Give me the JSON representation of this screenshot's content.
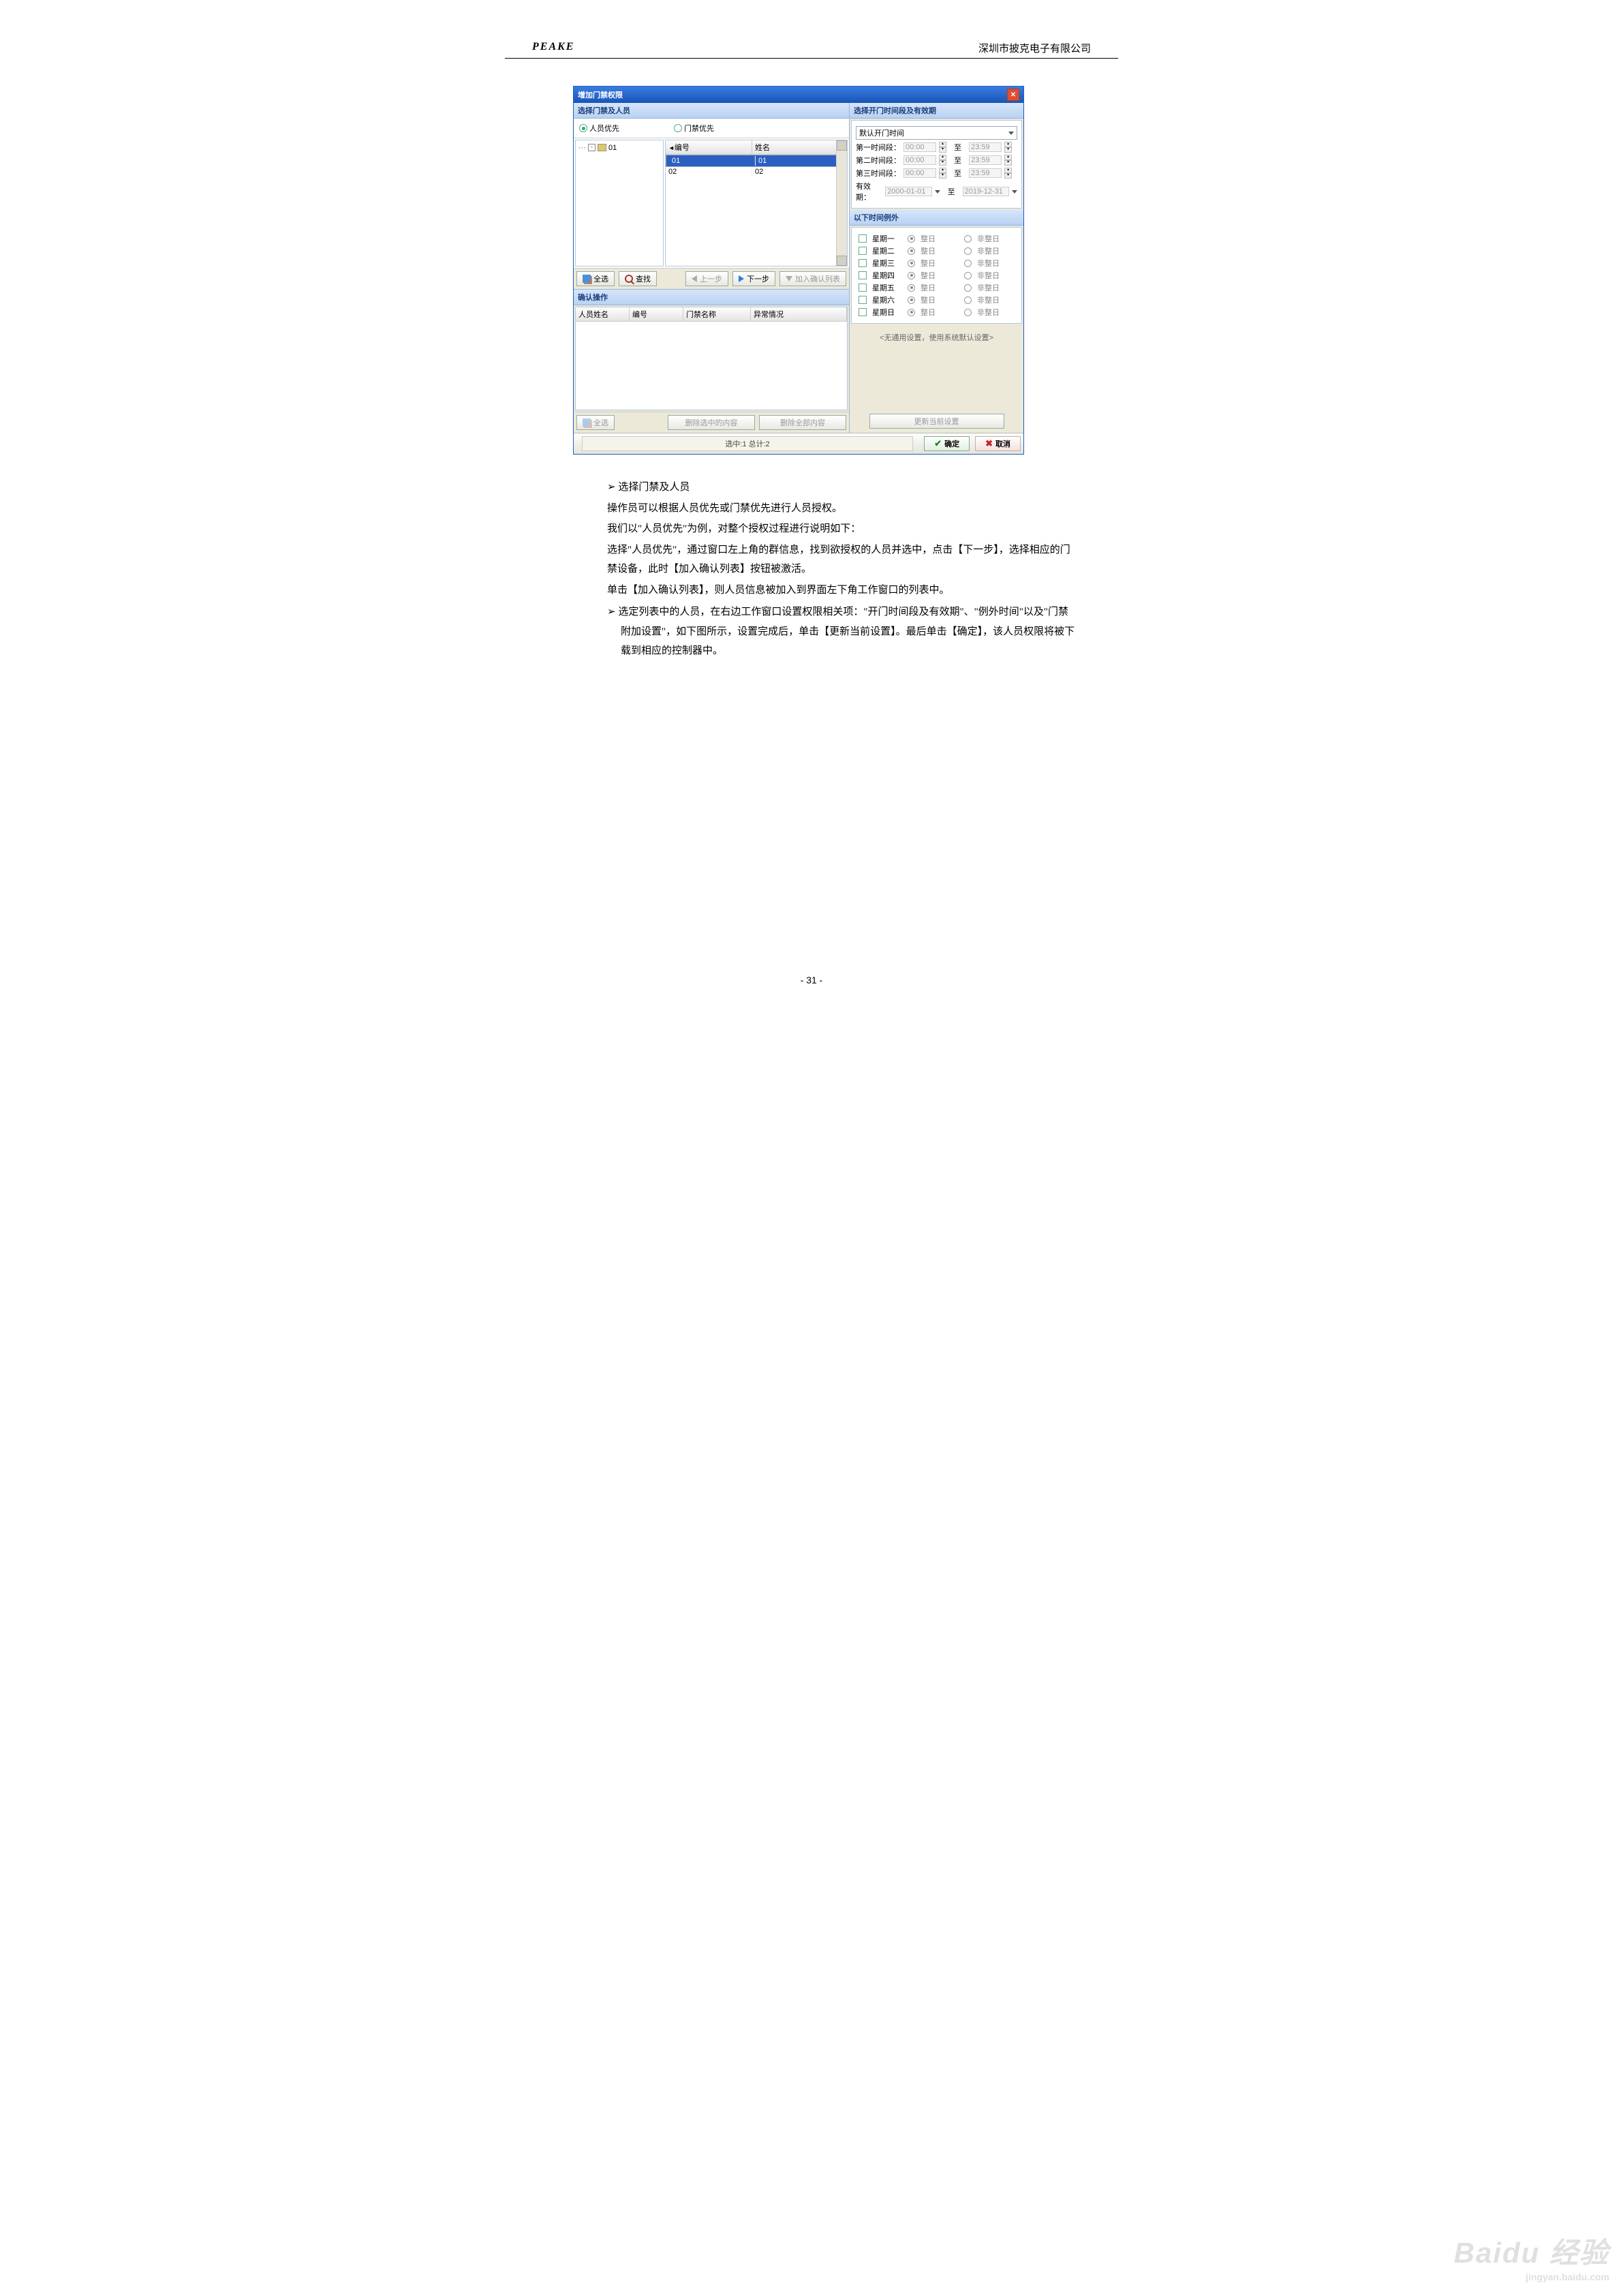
{
  "header": {
    "brand": "PEAKE",
    "company": "深圳市披克电子有限公司"
  },
  "win": {
    "title": "增加门禁权限",
    "left_header": "选择门禁及人员",
    "right_header": "选择开门时间段及有效期",
    "radio_person": "人员优先",
    "radio_door": "门禁优先",
    "tree_root": "01",
    "col_id": "编号",
    "col_name": "姓名",
    "rows": [
      {
        "id": "01",
        "name": "01"
      },
      {
        "id": "02",
        "name": "02"
      }
    ],
    "btn_all": "全选",
    "btn_find": "查找",
    "btn_prev": "上一步",
    "btn_next": "下一步",
    "btn_add": "加入确认列表",
    "confirm_header": "确认操作",
    "ccol1": "人员姓名",
    "ccol2": "编号",
    "ccol3": "门禁名称",
    "ccol4": "异常情况",
    "btn_delsel": "删除选中的内容",
    "btn_delall": "删除全部内容",
    "status": "选中:1 总计:2",
    "btn_ok": "确定",
    "btn_cancel": "取消"
  },
  "time": {
    "default": "默认开门时间",
    "seg1": "第一时间段：",
    "seg2": "第二时间段：",
    "seg3": "第三时间段：",
    "t0": "00:00",
    "t1": "23:59",
    "to": "至",
    "valid": "有效期：",
    "d0": "2000-01-01",
    "d1": "2019-12-31",
    "exc_header": "以下时间例外",
    "days": [
      "星期一",
      "星期二",
      "星期三",
      "星期四",
      "星期五",
      "星期六",
      "星期日"
    ],
    "whole": "整日",
    "nwhole": "非整日",
    "note": "<无通用设置，使用系统默认设置>",
    "btn_update": "更新当前设置"
  },
  "doc": {
    "b1": "选择门禁及人员",
    "p1": "操作员可以根据人员优先或门禁优先进行人员授权。",
    "p2": "我们以\"人员优先\"为例，对整个授权过程进行说明如下：",
    "p3": "选择\"人员优先\"，通过窗口左上角的群信息，找到欲授权的人员并选中，点击【下一步】，选择相应的门禁设备，此时【加入确认列表】按钮被激活。",
    "p4": "单击【加入确认列表】，则人员信息被加入到界面左下角工作窗口的列表中。",
    "b2": "选定列表中的人员，在右边工作窗口设置权限相关项：\"开门时间段及有效期\"、\"例外时间\"以及\"门禁附加设置\"，如下图所示，设置完成后，单击【更新当前设置】。最后单击【确定】，该人员权限将被下载到相应的控制器中。",
    "pgn": "- 31 -"
  },
  "wm": {
    "brand": "Baidu 经验",
    "url": "jingyan.baidu.com"
  }
}
